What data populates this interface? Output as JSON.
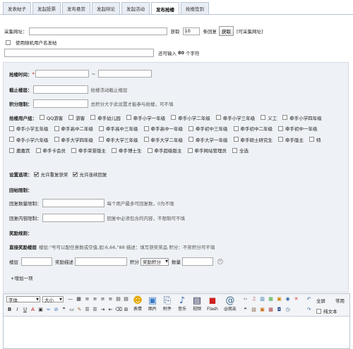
{
  "tabs": [
    {
      "label": "发表帖子"
    },
    {
      "label": "发起投票"
    },
    {
      "label": "发布悬赏"
    },
    {
      "label": "发起辩论"
    },
    {
      "label": "发起活动"
    },
    {
      "label": "发布抢楼"
    },
    {
      "label": "抢楼签到"
    }
  ],
  "active_tab": 5,
  "collect": {
    "label": "采集网址：",
    "url_value": "",
    "fetch_label": "获取",
    "count_value": "10",
    "count_suffix": "条回复",
    "fetch_button": "获取",
    "link_text": "[可采集网址]"
  },
  "random_user": {
    "label": "使用随机用户名发帖"
  },
  "title_field": {
    "value": "",
    "remain_prefix": "还可输入",
    "remain_count": "80",
    "remain_suffix": "个字符"
  },
  "form": {
    "time_label": "抢楼时间：",
    "time_req": "*",
    "time_sep": "~",
    "end_floor_label": "截止楼层：",
    "end_floor_hint": "抢楼活动截止楼层",
    "credit_limit_label": "积分限制：",
    "credit_limit_hint": "总积分大于此设置才能参与抢楼，可不填",
    "usergroup_label": "抢楼用户组：",
    "usergroups": [
      "QQ游客",
      "游客",
      "牵手幼儿园",
      "牵手小学一年级",
      "牵手小学二年级",
      "牵手小学三年级",
      "义工",
      "牵手小学四年级",
      "牵手小学五年级",
      "牵手高中二年级",
      "牵手高中三年级",
      "牵手高中一年级",
      "牵手初中三年级",
      "牵手初中二年级",
      "牵手初中一年级",
      "牵手小学六年级",
      "牵手大学四年级",
      "牵手大学三年级",
      "牵手大学二年级",
      "牵手大学一年级",
      "牵手硕士研究生",
      "牵手版主",
      "特",
      "邀嘉宾",
      "牵手卡会员",
      "牵手荣誉版主",
      "牵手博士生",
      "牵手超级版主",
      "牵手网站管理员",
      "全选"
    ],
    "options_label": "设置选项：",
    "opt_repeat": "允许重复获奖",
    "opt_continuous": "允许连续回复",
    "reply_limit_title": "回帖限制：",
    "reply_count_label": "回复数量限制：",
    "reply_count_hint": "每个用户最多可回复数，0为不限",
    "reply_content_label": "回复内容限制：",
    "reply_content_hint": "回复中必须包含的内容，不限制可不填",
    "reward_title": "奖励规则：",
    "direct_reward_label": "直接奖励楼层",
    "direct_reward_hint": "楼层:\"号可以配任意数或空值,如:6,66,\"88 描述：填写获奖奖品 积分：不奖积分可不填",
    "floor_label": "楼层",
    "reward_desc_label": "奖励描述",
    "credit_label": "积分",
    "credit_select": "奖励积分",
    "qty_label": "数量",
    "add_item": "+增加一项"
  },
  "editor": {
    "font_select": "字体",
    "size_select": "大小",
    "tools": [
      {
        "label": "表情",
        "icon": "smiley-icon"
      },
      {
        "label": "图片",
        "icon": "image-icon"
      },
      {
        "label": "附件",
        "icon": "attachment-icon"
      },
      {
        "label": "音乐",
        "icon": "music-icon"
      },
      {
        "label": "视频",
        "icon": "video-icon"
      },
      {
        "label": "Flash",
        "icon": "flash-icon"
      },
      {
        "label": "@朋友",
        "icon": "at-icon"
      }
    ],
    "fullscreen": "全屏",
    "common": "常用",
    "plain_text": "纯文本"
  }
}
